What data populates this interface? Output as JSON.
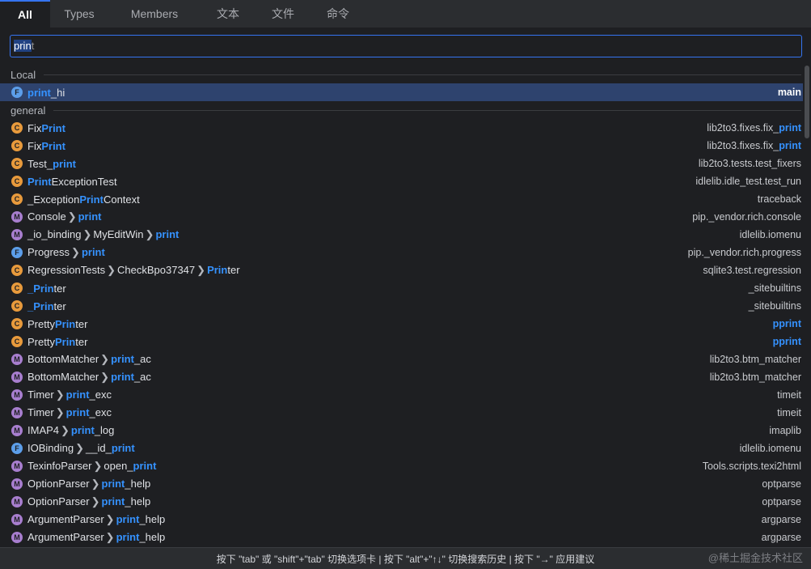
{
  "tabs": [
    {
      "label": "All",
      "active": true
    },
    {
      "label": "Types",
      "active": false
    },
    {
      "label": "Members",
      "active": false
    },
    {
      "label": "文本",
      "active": false
    },
    {
      "label": "文件",
      "active": false
    },
    {
      "label": "命令",
      "active": false
    }
  ],
  "search": {
    "selected": "prin",
    "rest": "t"
  },
  "sections": [
    {
      "title": "Local",
      "rows": [
        {
          "icon": "F",
          "icon_name": "function-icon",
          "parts": [
            [
              "h",
              "print"
            ],
            [
              "t",
              "_hi"
            ]
          ],
          "loc": [
            [
              "t",
              "main"
            ]
          ],
          "selected": true
        }
      ]
    },
    {
      "title": "general",
      "rows": [
        {
          "icon": "C",
          "icon_name": "class-icon",
          "parts": [
            [
              "t",
              "Fix"
            ],
            [
              "h",
              "Print"
            ]
          ],
          "loc": [
            [
              "t",
              "lib2to3.fixes.fix_"
            ],
            [
              "h",
              "print"
            ]
          ]
        },
        {
          "icon": "C",
          "icon_name": "class-icon",
          "parts": [
            [
              "t",
              "Fix"
            ],
            [
              "h",
              "Print"
            ]
          ],
          "loc": [
            [
              "t",
              "lib2to3.fixes.fix_"
            ],
            [
              "h",
              "print"
            ]
          ]
        },
        {
          "icon": "C",
          "icon_name": "class-icon",
          "parts": [
            [
              "t",
              "Test_"
            ],
            [
              "h",
              "print"
            ]
          ],
          "loc": [
            [
              "t",
              "lib2to3.tests.test_fixers"
            ]
          ]
        },
        {
          "icon": "C",
          "icon_name": "class-icon",
          "parts": [
            [
              "h",
              "Print"
            ],
            [
              "t",
              "ExceptionTest"
            ]
          ],
          "loc": [
            [
              "t",
              "idlelib.idle_test.test_run"
            ]
          ]
        },
        {
          "icon": "C",
          "icon_name": "class-icon",
          "parts": [
            [
              "t",
              "_Exception"
            ],
            [
              "h",
              "Print"
            ],
            [
              "t",
              "Context"
            ]
          ],
          "loc": [
            [
              "t",
              "traceback"
            ]
          ]
        },
        {
          "icon": "M",
          "icon_name": "method-icon",
          "parts": [
            [
              "t",
              "Console"
            ],
            [
              "s",
              "❯"
            ],
            [
              "h",
              "print"
            ]
          ],
          "loc": [
            [
              "t",
              "pip._vendor.rich.console"
            ]
          ]
        },
        {
          "icon": "M",
          "icon_name": "method-icon",
          "parts": [
            [
              "t",
              "_io_binding"
            ],
            [
              "s",
              "❯"
            ],
            [
              "t",
              "MyEditWin"
            ],
            [
              "s",
              "❯"
            ],
            [
              "h",
              "print"
            ]
          ],
          "loc": [
            [
              "t",
              "idlelib.iomenu"
            ]
          ]
        },
        {
          "icon": "F",
          "icon_name": "function-icon",
          "parts": [
            [
              "t",
              "Progress"
            ],
            [
              "s",
              "❯"
            ],
            [
              "h",
              "print"
            ]
          ],
          "loc": [
            [
              "t",
              "pip._vendor.rich.progress"
            ]
          ]
        },
        {
          "icon": "C",
          "icon_name": "class-icon",
          "parts": [
            [
              "t",
              "RegressionTests"
            ],
            [
              "s",
              "❯"
            ],
            [
              "t",
              "CheckBpo37347"
            ],
            [
              "s",
              "❯"
            ],
            [
              "h",
              "Prin"
            ],
            [
              "t",
              "ter"
            ]
          ],
          "loc": [
            [
              "t",
              "sqlite3.test.regression"
            ]
          ]
        },
        {
          "icon": "C",
          "icon_name": "class-icon",
          "parts": [
            [
              "h",
              "_Prin"
            ],
            [
              "t",
              "ter"
            ]
          ],
          "loc": [
            [
              "t",
              "_sitebuiltins"
            ]
          ]
        },
        {
          "icon": "C",
          "icon_name": "class-icon",
          "parts": [
            [
              "h",
              "_Prin"
            ],
            [
              "t",
              "ter"
            ]
          ],
          "loc": [
            [
              "t",
              "_sitebuiltins"
            ]
          ]
        },
        {
          "icon": "C",
          "icon_name": "class-icon",
          "parts": [
            [
              "t",
              "Pretty"
            ],
            [
              "h",
              "Prin"
            ],
            [
              "t",
              "ter"
            ]
          ],
          "loc": [
            [
              "h",
              "pprint"
            ]
          ]
        },
        {
          "icon": "C",
          "icon_name": "class-icon",
          "parts": [
            [
              "t",
              "Pretty"
            ],
            [
              "h",
              "Prin"
            ],
            [
              "t",
              "ter"
            ]
          ],
          "loc": [
            [
              "h",
              "pprint"
            ]
          ]
        },
        {
          "icon": "M",
          "icon_name": "method-icon",
          "parts": [
            [
              "t",
              "BottomMatcher"
            ],
            [
              "s",
              "❯"
            ],
            [
              "h",
              "print"
            ],
            [
              "t",
              "_ac"
            ]
          ],
          "loc": [
            [
              "t",
              "lib2to3.btm_matcher"
            ]
          ]
        },
        {
          "icon": "M",
          "icon_name": "method-icon",
          "parts": [
            [
              "t",
              "BottomMatcher"
            ],
            [
              "s",
              "❯"
            ],
            [
              "h",
              "print"
            ],
            [
              "t",
              "_ac"
            ]
          ],
          "loc": [
            [
              "t",
              "lib2to3.btm_matcher"
            ]
          ]
        },
        {
          "icon": "M",
          "icon_name": "method-icon",
          "parts": [
            [
              "t",
              "Timer"
            ],
            [
              "s",
              "❯"
            ],
            [
              "h",
              "print"
            ],
            [
              "t",
              "_exc"
            ]
          ],
          "loc": [
            [
              "t",
              "timeit"
            ]
          ]
        },
        {
          "icon": "M",
          "icon_name": "method-icon",
          "parts": [
            [
              "t",
              "Timer"
            ],
            [
              "s",
              "❯"
            ],
            [
              "h",
              "print"
            ],
            [
              "t",
              "_exc"
            ]
          ],
          "loc": [
            [
              "t",
              "timeit"
            ]
          ]
        },
        {
          "icon": "M",
          "icon_name": "method-icon",
          "parts": [
            [
              "t",
              "IMAP4"
            ],
            [
              "s",
              "❯"
            ],
            [
              "h",
              "print"
            ],
            [
              "t",
              "_log"
            ]
          ],
          "loc": [
            [
              "t",
              "imaplib"
            ]
          ]
        },
        {
          "icon": "F",
          "icon_name": "function-icon",
          "parts": [
            [
              "t",
              "IOBinding"
            ],
            [
              "s",
              "❯"
            ],
            [
              "t",
              "__id_"
            ],
            [
              "h",
              "print"
            ]
          ],
          "loc": [
            [
              "t",
              "idlelib.iomenu"
            ]
          ]
        },
        {
          "icon": "M",
          "icon_name": "method-icon",
          "parts": [
            [
              "t",
              "TexinfoParser"
            ],
            [
              "s",
              "❯"
            ],
            [
              "t",
              "open_"
            ],
            [
              "h",
              "print"
            ]
          ],
          "loc": [
            [
              "t",
              "Tools.scripts.texi2html"
            ]
          ]
        },
        {
          "icon": "M",
          "icon_name": "method-icon",
          "parts": [
            [
              "t",
              "OptionParser"
            ],
            [
              "s",
              "❯"
            ],
            [
              "h",
              "print"
            ],
            [
              "t",
              "_help"
            ]
          ],
          "loc": [
            [
              "t",
              "optparse"
            ]
          ]
        },
        {
          "icon": "M",
          "icon_name": "method-icon",
          "parts": [
            [
              "t",
              "OptionParser"
            ],
            [
              "s",
              "❯"
            ],
            [
              "h",
              "print"
            ],
            [
              "t",
              "_help"
            ]
          ],
          "loc": [
            [
              "t",
              "optparse"
            ]
          ]
        },
        {
          "icon": "M",
          "icon_name": "method-icon",
          "parts": [
            [
              "t",
              "ArgumentParser"
            ],
            [
              "s",
              "❯"
            ],
            [
              "h",
              "print"
            ],
            [
              "t",
              "_help"
            ]
          ],
          "loc": [
            [
              "t",
              "argparse"
            ]
          ]
        },
        {
          "icon": "M",
          "icon_name": "method-icon",
          "parts": [
            [
              "t",
              "ArgumentParser"
            ],
            [
              "s",
              "❯"
            ],
            [
              "h",
              "print"
            ],
            [
              "t",
              "_help"
            ]
          ],
          "loc": [
            [
              "t",
              "argparse"
            ]
          ]
        }
      ]
    }
  ],
  "footer": {
    "hint": "按下 \"tab\" 或 \"shift\"+\"tab\" 切换选项卡 | 按下 \"alt\"+\"↑↓\" 切换搜索历史 | 按下 \"→\" 应用建议"
  },
  "watermark": "@稀土掘金技术社区"
}
